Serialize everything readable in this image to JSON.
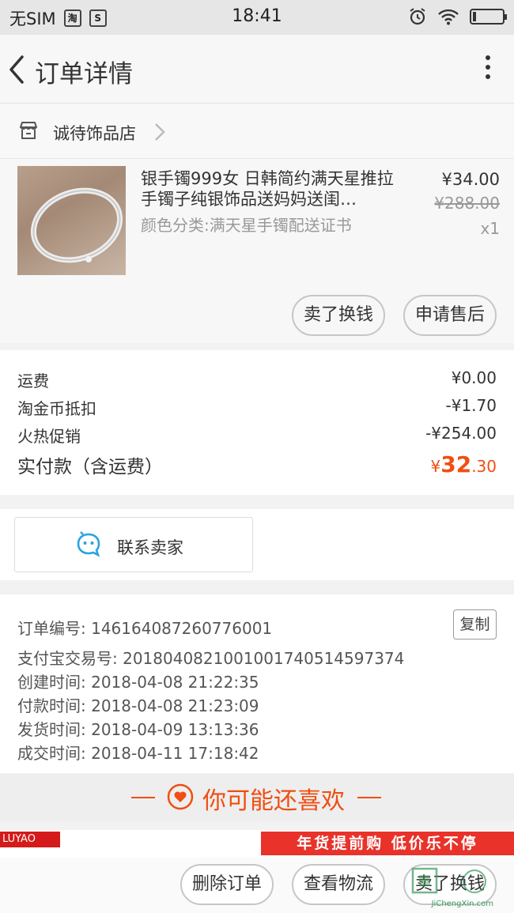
{
  "status_bar": {
    "carrier": "无SIM",
    "time": "18:41",
    "app_icon_1": "淘",
    "app_icon_2": "S"
  },
  "nav": {
    "title": "订单详情"
  },
  "shop": {
    "name": "诚待饰品店"
  },
  "product": {
    "title": "银手镯999女 日韩简约满天星推拉手镯子纯银饰品送妈妈送闺…",
    "sku": "颜色分类:满天星手镯配送证书",
    "price": "¥34.00",
    "original_price": "¥288.00",
    "quantity": "x1",
    "buttons": {
      "sell": "卖了换钱",
      "after_sales": "申请售后"
    }
  },
  "fees": {
    "shipping_label": "运费",
    "shipping_value": "¥0.00",
    "coin_label": "淘金币抵扣",
    "coin_value": "-¥1.70",
    "promo_label": "火热促销",
    "promo_value": "-¥254.00",
    "total_label": "实付款（含运费）",
    "total_symbol": "¥",
    "total_integer": "32",
    "total_decimal": ".30"
  },
  "contact": {
    "label": "联系卖家"
  },
  "order_info": {
    "order_no": "订单编号: 146164087260776001",
    "copy_label": "复制",
    "alipay_no": "支付宝交易号: 2018040821001001740514597374",
    "created": "创建时间: 2018-04-08 21:22:35",
    "paid": "付款时间: 2018-04-08 21:23:09",
    "shipped": "发货时间: 2018-04-09 13:13:36",
    "completed": "成交时间: 2018-04-11 17:18:42"
  },
  "recommend": {
    "title": "你可能还喜欢"
  },
  "banners": {
    "brand": "LUYAO",
    "promo": "年货提前购 低价乐不停"
  },
  "bottom_bar": {
    "delete": "删除订单",
    "logistics": "查看物流",
    "sell": "卖了换钱"
  },
  "watermark": {
    "url": "JiChengXin.com"
  },
  "colors": {
    "accent": "#f04e12",
    "contact_icon": "#29a3e0",
    "promo_red": "#e8322a"
  }
}
